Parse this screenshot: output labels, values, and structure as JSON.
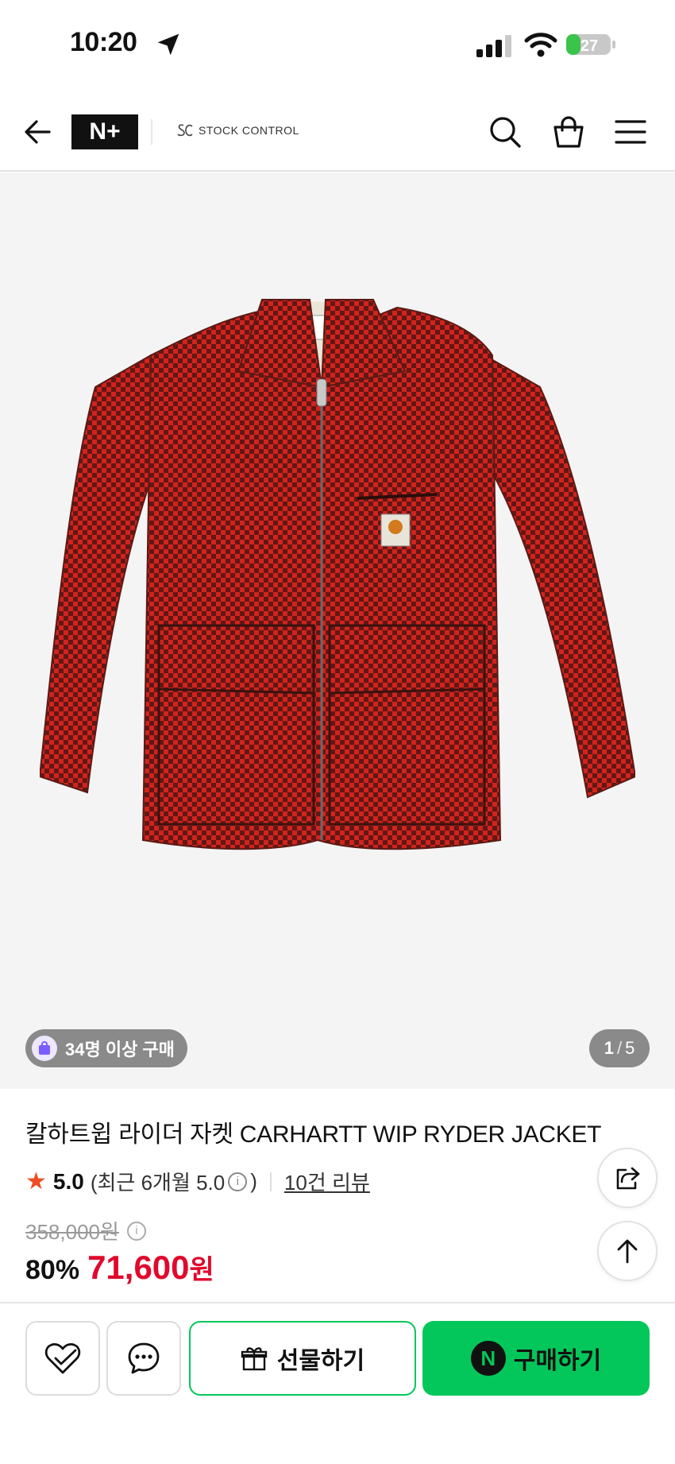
{
  "status_bar": {
    "time": "10:20",
    "battery": "27"
  },
  "header": {
    "brand_badge": "N+",
    "store_name": "STOCK CONTROL"
  },
  "product_image": {
    "buyers_badge": "34명 이상 구매",
    "page_current": "1",
    "page_sep": "/",
    "page_total": "5"
  },
  "product": {
    "title": "칼하트윕 라이더 자켓 CARHARTT WIP RYDER JACKET",
    "rating_star": "★",
    "rating": "5.0",
    "recent_prefix": "(최근 6개월 5.0",
    "recent_suffix": ")",
    "review_link": "10건 리뷰",
    "original_price": "358,000원",
    "discount": "80%",
    "sale_price": "71,600",
    "currency": "원"
  },
  "bottom_bar": {
    "gift_label": "선물하기",
    "buy_label": "구매하기",
    "buy_badge": "N"
  },
  "colors": {
    "naver_green": "#03c75a",
    "sale_red": "#e0092c",
    "star_orange": "#f04a24",
    "jacket_red": "#c9201d"
  }
}
